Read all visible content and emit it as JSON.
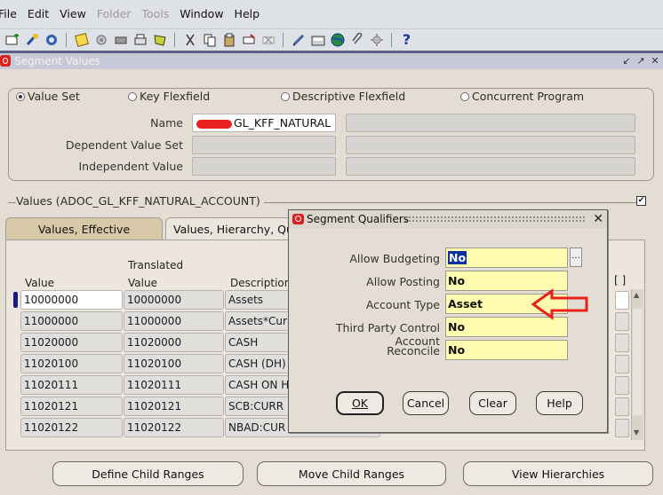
{
  "menubar": {
    "items": [
      {
        "label": "File",
        "enabled": true
      },
      {
        "label": "Edit",
        "enabled": true
      },
      {
        "label": "View",
        "enabled": true
      },
      {
        "label": "Folder",
        "enabled": false
      },
      {
        "label": "Tools",
        "enabled": false
      },
      {
        "label": "Window",
        "enabled": true
      },
      {
        "label": "Help",
        "enabled": true
      }
    ]
  },
  "toolbar": {
    "icons": [
      "new-icon",
      "navigator-icon",
      "close-form-icon",
      "save-icon",
      "print-icon",
      "find-icon",
      "zoom-icon",
      "attachments-icon",
      "translations-icon",
      "cut-icon",
      "copy-icon",
      "paste-icon",
      "clear-record-icon",
      "delete-icon",
      "edit-field-icon",
      "folder-icon",
      "world-icon",
      "attach-icon",
      "tools-icon",
      "help-icon"
    ]
  },
  "window": {
    "title": "Segment Values",
    "controls": [
      "restore",
      "maximize",
      "close"
    ]
  },
  "mode_radios": [
    {
      "label": "Value Set",
      "selected": true
    },
    {
      "label": "Key Flexfield",
      "selected": false
    },
    {
      "label": "Descriptive Flexfield",
      "selected": false
    },
    {
      "label": "Concurrent Program",
      "selected": false
    }
  ],
  "fields": {
    "name_label": "Name",
    "name_value": "GL_KFF_NATURAL",
    "dependent_label": "Dependent Value Set",
    "independent_label": "Independent Value"
  },
  "values_section": {
    "title": "Values (ADOC_GL_KFF_NATURAL_ACCOUNT)",
    "tabs": [
      "Values, Effective",
      "Values, Hierarchy, Qu"
    ],
    "col_value": "Value",
    "col_translated_top": "Translated",
    "col_translated_bottom": "Value",
    "col_description": "Description",
    "bracket": "[ ]",
    "rows": [
      {
        "value": "10000000",
        "translated": "10000000",
        "description": "Assets"
      },
      {
        "value": "11000000",
        "translated": "11000000",
        "description": "Assets*Cur"
      },
      {
        "value": "11020000",
        "translated": "11020000",
        "description": "CASH"
      },
      {
        "value": "11020100",
        "translated": "11020100",
        "description": "CASH (DH)"
      },
      {
        "value": "11020111",
        "translated": "11020111",
        "description": "CASH ON H"
      },
      {
        "value": "11020121",
        "translated": "11020121",
        "description": "SCB:CURR"
      },
      {
        "value": "11020122",
        "translated": "11020122",
        "description": "NBAD:CUR"
      }
    ]
  },
  "buttons": {
    "define_child": "Define Child Ranges",
    "move_child": "Move Child Ranges",
    "view_hierarchies": "View Hierarchies"
  },
  "dialog": {
    "title": "Segment Qualifiers",
    "qualifiers": [
      {
        "label": "Allow Budgeting",
        "value": "No"
      },
      {
        "label": "Allow Posting",
        "value": "No"
      },
      {
        "label": "Account Type",
        "value": "Asset"
      },
      {
        "label": "Third Party Control Account",
        "value": "No"
      },
      {
        "label": "Reconcile",
        "value": "No"
      }
    ],
    "buttons": [
      "OK",
      "Cancel",
      "Clear",
      "Help"
    ],
    "lov": "..."
  },
  "colors": {
    "qualifier_field": "#fffcb0",
    "annotation_arrow": "#e8201e",
    "oracle_red": "#d8231b"
  }
}
